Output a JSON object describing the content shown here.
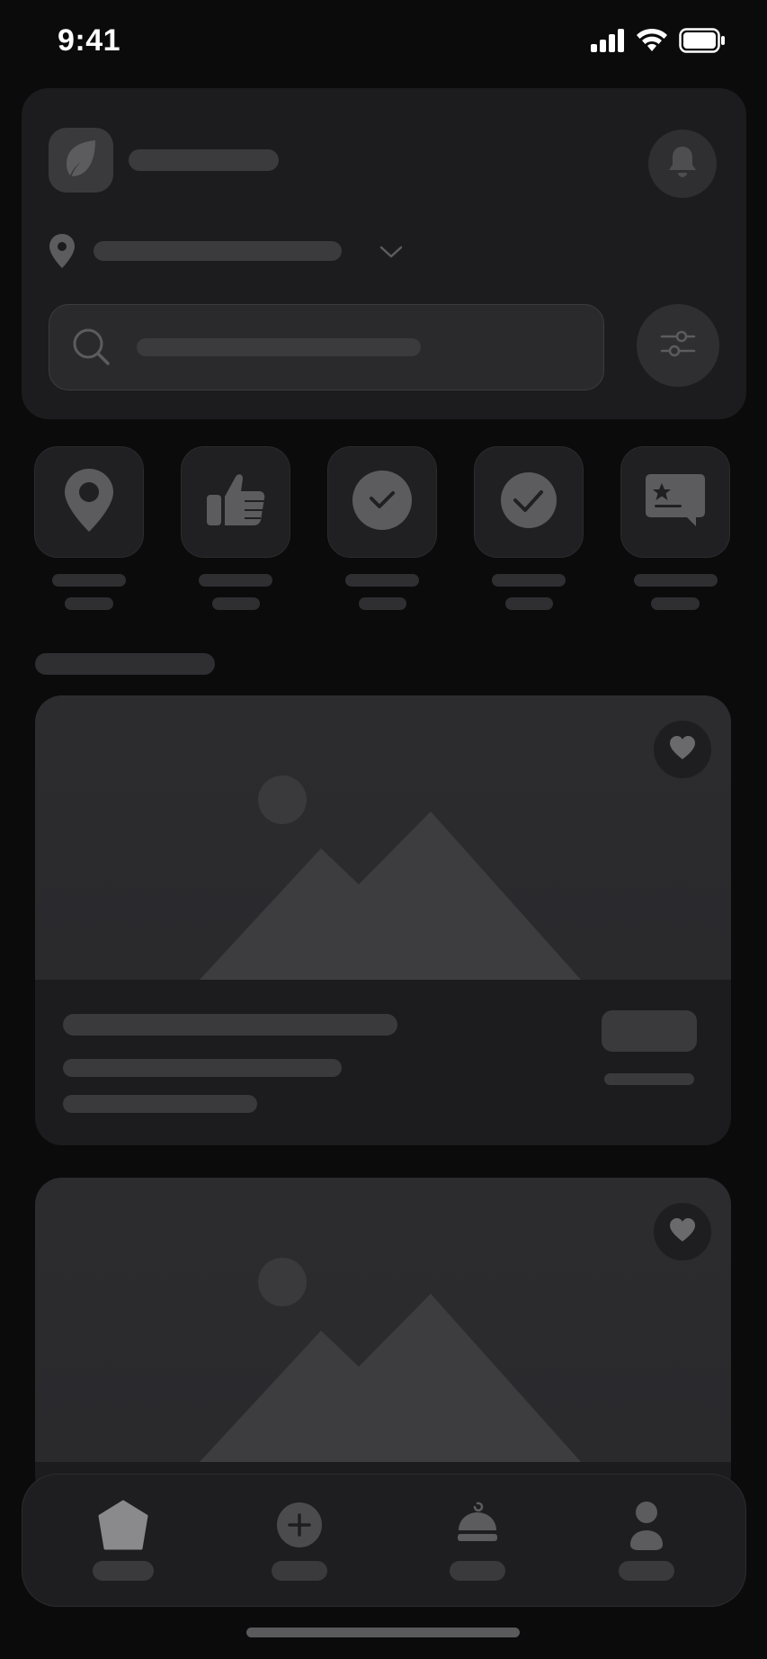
{
  "status_bar": {
    "time": "9:41",
    "icons": [
      "cellular-signal-icon",
      "wifi-icon",
      "battery-icon"
    ]
  },
  "header": {
    "logo_icon": "leaf-icon",
    "notification_icon": "bell-icon",
    "location_icon": "map-pin-icon",
    "location_dropdown_icon": "chevron-down-icon",
    "search_icon": "search-icon",
    "filter_icon": "sliders-icon"
  },
  "categories": [
    {
      "icon": "map-pin-icon"
    },
    {
      "icon": "thumbs-up-icon"
    },
    {
      "icon": "check-circle-icon"
    },
    {
      "icon": "check-circle-icon"
    },
    {
      "icon": "star-message-icon"
    }
  ],
  "listings": [
    {
      "image_icon": "image-placeholder-icon",
      "favorite_icon": "heart-icon"
    },
    {
      "image_icon": "image-placeholder-icon",
      "favorite_icon": "heart-icon"
    }
  ],
  "tab_bar": {
    "items": [
      {
        "icon": "home-icon"
      },
      {
        "icon": "add-circle-icon"
      },
      {
        "icon": "cloche-icon"
      },
      {
        "icon": "profile-icon"
      }
    ]
  },
  "colors": {
    "background": "#0b0b0c",
    "surface": "#1c1c1e",
    "placeholder": "#3b3b3e",
    "icon": "#5c5c5f"
  }
}
